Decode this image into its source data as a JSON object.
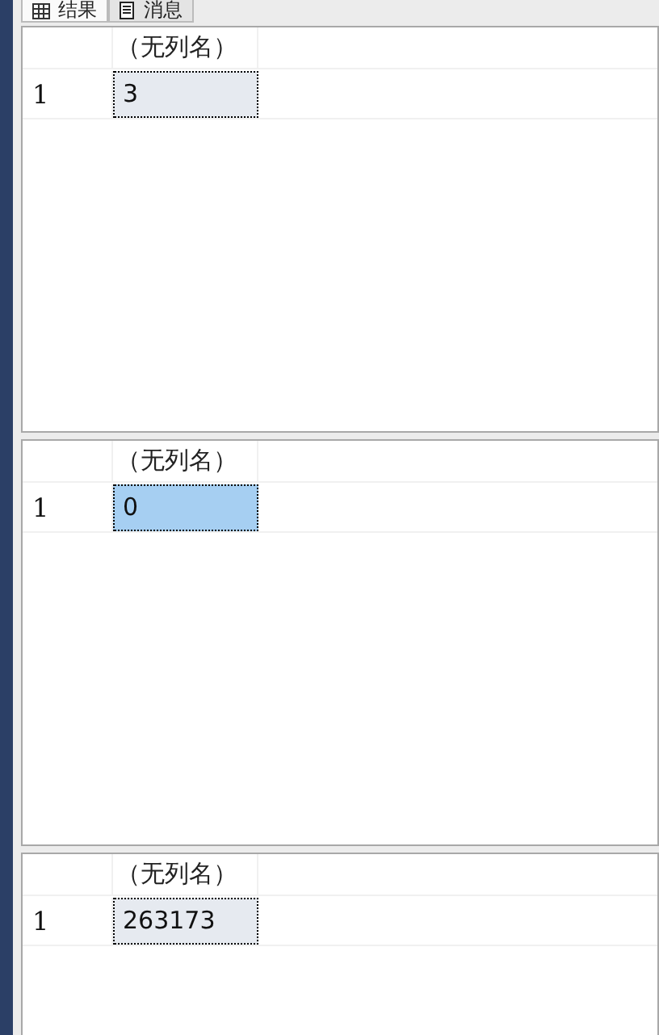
{
  "tabs": [
    {
      "label": "结果",
      "kind": "grid",
      "selected": true
    },
    {
      "label": "消息",
      "kind": "doc",
      "selected": false
    }
  ],
  "result_sets": [
    {
      "columns": [
        "（无列名）"
      ],
      "rows": [
        {
          "row_number": "1",
          "cells": [
            {
              "value": "3",
              "selected": true,
              "active": false
            }
          ]
        }
      ]
    },
    {
      "columns": [
        "（无列名）"
      ],
      "rows": [
        {
          "row_number": "1",
          "cells": [
            {
              "value": "0",
              "selected": true,
              "active": true
            }
          ]
        }
      ]
    },
    {
      "columns": [
        "（无列名）"
      ],
      "rows": [
        {
          "row_number": "1",
          "cells": [
            {
              "value": "263173",
              "selected": true,
              "active": false
            }
          ]
        }
      ]
    }
  ]
}
